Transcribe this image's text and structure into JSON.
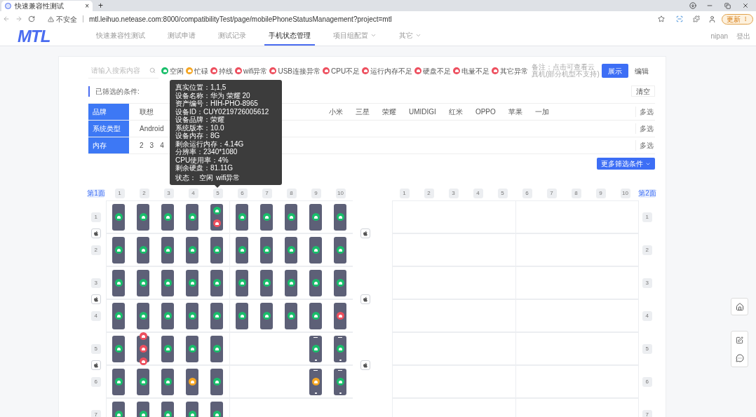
{
  "browser": {
    "tab_title": "快速兼容性测试",
    "tab_close": "×",
    "new_tab": "+",
    "security": "不安全",
    "url": "mtl.leihuo.netease.com:8000/compatibilityTest/page/mobilePhoneStatusManagement?project=mtl",
    "update_button": "更新"
  },
  "nav": {
    "logo": "MTL",
    "items": [
      {
        "label": "快速兼容性测试",
        "selected": false,
        "dropdown": false
      },
      {
        "label": "测试申请",
        "selected": false,
        "dropdown": false
      },
      {
        "label": "测试记录",
        "selected": false,
        "dropdown": false
      },
      {
        "label": "手机状态管理",
        "selected": true,
        "dropdown": false
      },
      {
        "label": "项目组配置",
        "selected": false,
        "dropdown": true
      },
      {
        "label": "其它",
        "selected": false,
        "dropdown": true
      }
    ],
    "user": "nipan",
    "logout": "登出"
  },
  "search": {
    "placeholder": "请输入搜索内容"
  },
  "legend": [
    {
      "label": "空闲",
      "color": "#19be6b"
    },
    {
      "label": "忙碌",
      "color": "#f5a623"
    },
    {
      "label": "掉线",
      "color": "#ed4f5e"
    },
    {
      "label": "wifi异常",
      "color": "#ed4f5e"
    },
    {
      "label": "USB连接异常",
      "color": "#ed4f5e"
    },
    {
      "label": "CPU不足",
      "color": "#ed4f5e"
    },
    {
      "label": "运行内存不足",
      "color": "#ed4f5e"
    },
    {
      "label": "硬盘不足",
      "color": "#ed4f5e"
    },
    {
      "label": "电量不足",
      "color": "#ed4f5e"
    },
    {
      "label": "其它异常",
      "color": "#ed4f5e"
    }
  ],
  "note": "备注：点击可查看云真机(部分机型不支持)",
  "view_buttons": [
    {
      "label": "展示",
      "selected": true
    },
    {
      "label": "编辑",
      "selected": false
    }
  ],
  "filter": {
    "label": "已筛选的条件:",
    "clear": "清空",
    "more": "更多筛选条件",
    "rows": [
      {
        "label": "品牌",
        "options": [
          "联想"
        ],
        "options_after": [
          "小米",
          "三星",
          "荣耀",
          "UMIDIGI",
          "红米",
          "OPPO",
          "苹果",
          "一加"
        ],
        "action": "多选"
      },
      {
        "label": "系统类型",
        "options": [
          "Android"
        ],
        "options_after": [],
        "action": "多选"
      },
      {
        "label": "内存",
        "options": [
          "2",
          "3",
          "4"
        ],
        "options_after": [],
        "action": "多选"
      }
    ]
  },
  "tooltip": {
    "lines": [
      "真实位置：1,1,5",
      "设备名称：华为 荣耀 20",
      "资产编号：HIH-PHO-8965",
      "设备ID：CUY0219726005612",
      "设备品牌：荣耀",
      "系统版本：10.0",
      "设备内存：8G",
      "剩余运行内存：4.14G",
      "分辨率：2340*1080",
      "CPU使用率：4%",
      "剩余硬盘：81.11G"
    ],
    "status_label": "状态：",
    "status_values": [
      "空闲",
      "wifi异常"
    ]
  },
  "shelves": [
    {
      "page": "第1面",
      "columns": [
        "1",
        "2",
        "3",
        "4",
        "5",
        "6",
        "7",
        "8",
        "9",
        "10"
      ],
      "rows": [
        {
          "label": "1",
          "apple": true,
          "phones": [
            {
              "kind": "android",
              "dots": [
                {
                  "color": "#19be6b"
                }
              ]
            },
            {
              "kind": "android",
              "dots": [
                {
                  "color": "#19be6b"
                }
              ]
            },
            {
              "kind": "android",
              "dots": [
                {
                  "color": "#19be6b"
                }
              ]
            },
            {
              "kind": "android",
              "dots": [
                {
                  "color": "#19be6b"
                }
              ]
            },
            {
              "kind": "android",
              "dots": [
                {
                  "color": "#19be6b"
                },
                {
                  "color": "#ed4f5e"
                }
              ]
            },
            {
              "kind": "android",
              "dots": [
                {
                  "color": "#19be6b"
                }
              ]
            },
            {
              "kind": "android",
              "dots": [
                {
                  "color": "#19be6b"
                }
              ]
            },
            {
              "kind": "android",
              "dots": [
                {
                  "color": "#19be6b"
                }
              ]
            },
            {
              "kind": "android",
              "dots": [
                {
                  "color": "#19be6b"
                }
              ]
            },
            {
              "kind": "android",
              "dots": [
                {
                  "color": "#19be6b"
                }
              ]
            }
          ]
        },
        {
          "label": "2",
          "apple": false,
          "phones": [
            {
              "kind": "android",
              "dots": [
                {
                  "color": "#19be6b"
                }
              ]
            },
            {
              "kind": "android",
              "dots": [
                {
                  "color": "#19be6b"
                }
              ]
            },
            {
              "kind": "android",
              "dots": [
                {
                  "color": "#19be6b"
                }
              ]
            },
            {
              "kind": "android",
              "dots": [
                {
                  "color": "#19be6b"
                }
              ]
            },
            {
              "kind": "android",
              "dots": [
                {
                  "color": "#19be6b"
                }
              ]
            },
            {
              "kind": "android",
              "dots": [
                {
                  "color": "#19be6b"
                }
              ]
            },
            {
              "kind": "android",
              "dots": [
                {
                  "color": "#19be6b"
                }
              ]
            },
            {
              "kind": "android",
              "dots": [
                {
                  "color": "#19be6b"
                }
              ]
            },
            {
              "kind": "android",
              "dots": [
                {
                  "color": "#19be6b"
                }
              ]
            },
            {
              "kind": "android",
              "dots": [
                {
                  "color": "#19be6b"
                }
              ]
            }
          ]
        },
        {
          "label": "3",
          "apple": true,
          "phones": [
            {
              "kind": "android",
              "dots": [
                {
                  "color": "#19be6b"
                }
              ]
            },
            {
              "kind": "android",
              "dots": [
                {
                  "color": "#19be6b"
                }
              ]
            },
            {
              "kind": "android",
              "dots": [
                {
                  "color": "#19be6b"
                }
              ]
            },
            {
              "kind": "android",
              "dots": [
                {
                  "color": "#19be6b"
                }
              ]
            },
            {
              "kind": "android",
              "dots": [
                {
                  "color": "#19be6b"
                }
              ]
            },
            {
              "kind": "android",
              "dots": [
                {
                  "color": "#19be6b"
                }
              ]
            },
            {
              "kind": "android",
              "dots": [
                {
                  "color": "#19be6b"
                }
              ]
            },
            {
              "kind": "android",
              "dots": [
                {
                  "color": "#19be6b"
                }
              ]
            },
            {
              "kind": "android",
              "dots": [
                {
                  "color": "#19be6b"
                }
              ]
            },
            {
              "kind": "android",
              "dots": [
                {
                  "color": "#19be6b"
                }
              ]
            }
          ]
        },
        {
          "label": "4",
          "apple": false,
          "phones": [
            {
              "kind": "android",
              "dots": [
                {
                  "color": "#19be6b"
                }
              ]
            },
            {
              "kind": "android",
              "dots": [
                {
                  "color": "#19be6b"
                }
              ]
            },
            {
              "kind": "android",
              "dots": [
                {
                  "color": "#19be6b"
                }
              ]
            },
            {
              "kind": "android",
              "dots": [
                {
                  "color": "#19be6b"
                }
              ]
            },
            {
              "kind": "android",
              "dots": [
                {
                  "color": "#19be6b"
                }
              ]
            },
            {
              "kind": "android",
              "dots": [
                {
                  "color": "#19be6b"
                }
              ]
            },
            {
              "kind": "android",
              "dots": [
                {
                  "color": "#19be6b"
                }
              ]
            },
            {
              "kind": "android",
              "dots": [
                {
                  "color": "#19be6b"
                }
              ]
            },
            {
              "kind": "android",
              "dots": [
                {
                  "color": "#19be6b"
                }
              ]
            },
            {
              "kind": "android",
              "dots": [
                {
                  "color": "#ed4f5e"
                }
              ]
            }
          ]
        },
        {
          "label": "5",
          "apple": true,
          "phones": [
            {
              "kind": "android",
              "dots": [
                {
                  "color": "#19be6b"
                }
              ]
            },
            {
              "kind": "android",
              "dots": [
                {
                  "color": "#ed4f5e"
                },
                {
                  "color": "#ed4f5e"
                },
                {
                  "color": "#ed4f5e"
                }
              ]
            },
            {
              "kind": "android",
              "dots": [
                {
                  "color": "#19be6b"
                }
              ]
            },
            {
              "kind": "android",
              "dots": [
                {
                  "color": "#19be6b"
                }
              ]
            },
            {
              "kind": "android",
              "dots": [
                {
                  "color": "#19be6b"
                }
              ]
            },
            {
              "kind": "empty"
            },
            {
              "kind": "empty"
            },
            {
              "kind": "empty"
            },
            {
              "kind": "iphone",
              "dots": [
                {
                  "color": "#19be6b"
                }
              ]
            },
            {
              "kind": "iphone",
              "dots": [
                {
                  "color": "#19be6b"
                }
              ]
            }
          ]
        },
        {
          "label": "6",
          "apple": false,
          "phones": [
            {
              "kind": "android",
              "dots": [
                {
                  "color": "#19be6b"
                }
              ]
            },
            {
              "kind": "android",
              "dots": [
                {
                  "color": "#19be6b"
                }
              ]
            },
            {
              "kind": "android",
              "dots": [
                {
                  "color": "#19be6b"
                }
              ]
            },
            {
              "kind": "android",
              "dots": [
                {
                  "color": "#f5a623"
                }
              ]
            },
            {
              "kind": "android",
              "dots": [
                {
                  "color": "#19be6b"
                }
              ]
            },
            {
              "kind": "empty"
            },
            {
              "kind": "empty"
            },
            {
              "kind": "empty"
            },
            {
              "kind": "iphone",
              "dots": [
                {
                  "color": "#f5a623"
                }
              ]
            },
            {
              "kind": "iphone",
              "dots": [
                {
                  "color": "#19be6b"
                }
              ]
            }
          ]
        },
        {
          "label": "7",
          "apple": false,
          "phones": [
            {
              "kind": "android",
              "dots": [
                {
                  "color": "#19be6b"
                }
              ]
            },
            {
              "kind": "android",
              "dots": [
                {
                  "color": "#19be6b"
                }
              ]
            },
            {
              "kind": "android",
              "dots": [
                {
                  "color": "#19be6b"
                }
              ]
            },
            {
              "kind": "android",
              "dots": [
                {
                  "color": "#19be6b"
                }
              ]
            },
            {
              "kind": "android",
              "dots": [
                {
                  "color": "#19be6b"
                }
              ]
            },
            {
              "kind": "empty"
            },
            {
              "kind": "empty"
            },
            {
              "kind": "empty"
            },
            {
              "kind": "empty"
            },
            {
              "kind": "empty"
            }
          ]
        }
      ]
    },
    {
      "page": "第2面",
      "columns": [
        "1",
        "2",
        "3",
        "4",
        "5",
        "6",
        "7",
        "8",
        "9",
        "10"
      ],
      "rows": [
        {
          "label": "1"
        },
        {
          "label": "2"
        },
        {
          "label": "3"
        },
        {
          "label": "4"
        },
        {
          "label": "5"
        },
        {
          "label": "6"
        },
        {
          "label": "7"
        }
      ]
    }
  ]
}
